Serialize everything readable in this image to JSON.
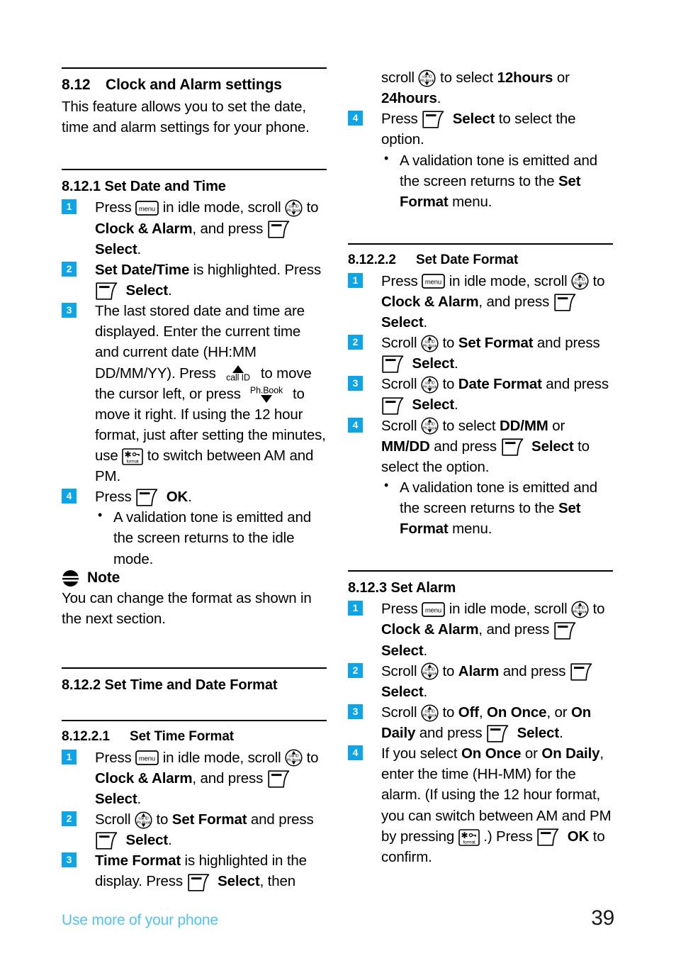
{
  "document": {
    "page_number": "39",
    "footer_label": "Use more of your phone",
    "accent_color": "#0CA6E8",
    "footer_color": "#4FC3F7"
  },
  "icons": {
    "menu": "menu-key-icon",
    "menu_label": "menu",
    "scroll": "scroll-navigation-icon",
    "scroll_top_label": "call ID",
    "scroll_bottom_label": "Ph.Book",
    "softkey": "soft-key-icon",
    "format": "format-star-key-icon",
    "format_label": "format",
    "callid_up": "call-id-up-arrow-icon",
    "callid_label": "call ID",
    "phbook_down": "phone-book-down-arrow-icon",
    "phbook_label": "Ph.Book",
    "note": "note-icon"
  },
  "left_column": {
    "section_812": {
      "number": "8.12",
      "title": "Clock and Alarm settings",
      "intro": "This feature allows you to set the date, time and alarm settings for your phone."
    },
    "section_8121": {
      "heading": "8.12.1 Set Date and Time",
      "steps": [
        {
          "num": "1",
          "parts": [
            {
              "t": "text",
              "v": "Press "
            },
            {
              "t": "icon",
              "v": "menu"
            },
            {
              "t": "text",
              "v": " in idle mode, scroll "
            },
            {
              "t": "icon",
              "v": "scroll"
            },
            {
              "t": "text",
              "v": " to "
            },
            {
              "t": "bold",
              "v": "Clock & Alarm"
            },
            {
              "t": "text",
              "v": ", and press "
            },
            {
              "t": "icon",
              "v": "softkey"
            },
            {
              "t": "bold",
              "v": "Select"
            },
            {
              "t": "text",
              "v": "."
            }
          ]
        },
        {
          "num": "2",
          "parts": [
            {
              "t": "bold",
              "v": "Set Date/Time"
            },
            {
              "t": "text",
              "v": " is highlighted. Press "
            },
            {
              "t": "icon",
              "v": "softkey"
            },
            {
              "t": "bold",
              "v": "Select"
            },
            {
              "t": "text",
              "v": "."
            }
          ]
        },
        {
          "num": "3",
          "parts": [
            {
              "t": "text",
              "v": "The last stored date and time are displayed. Enter the current time and current date (HH:MM DD/MM/YY). Press "
            },
            {
              "t": "icon",
              "v": "callid_up"
            },
            {
              "t": "text",
              "v": " to move the cursor left, or press "
            },
            {
              "t": "icon",
              "v": "phbook_down"
            },
            {
              "t": "text",
              "v": " to move it right. If using the 12 hour format, just after setting the minutes, use "
            },
            {
              "t": "icon",
              "v": "format"
            },
            {
              "t": "text",
              "v": " to switch between AM and PM."
            }
          ]
        },
        {
          "num": "4",
          "parts": [
            {
              "t": "text",
              "v": "Press "
            },
            {
              "t": "icon",
              "v": "softkey"
            },
            {
              "t": "bold",
              "v": "OK"
            },
            {
              "t": "text",
              "v": "."
            }
          ],
          "bullets": [
            [
              {
                "t": "text",
                "v": "A validation tone is emitted and the screen returns to the idle mode."
              }
            ]
          ]
        }
      ]
    },
    "note": {
      "title": "Note",
      "body": "You can change the format as shown in the next section."
    },
    "section_8122": {
      "heading": "8.12.2 Set Time and Date Format"
    },
    "section_81221": {
      "number": "8.12.2.1",
      "title": "Set Time Format",
      "steps": [
        {
          "num": "1",
          "parts": [
            {
              "t": "text",
              "v": "Press "
            },
            {
              "t": "icon",
              "v": "menu"
            },
            {
              "t": "text",
              "v": " in idle mode, scroll "
            },
            {
              "t": "icon",
              "v": "scroll"
            },
            {
              "t": "text",
              "v": " to "
            },
            {
              "t": "bold",
              "v": "Clock & Alarm"
            },
            {
              "t": "text",
              "v": ", and press "
            },
            {
              "t": "icon",
              "v": "softkey"
            },
            {
              "t": "bold",
              "v": "Select"
            },
            {
              "t": "text",
              "v": "."
            }
          ]
        },
        {
          "num": "2",
          "parts": [
            {
              "t": "text",
              "v": "Scroll "
            },
            {
              "t": "icon",
              "v": "scroll"
            },
            {
              "t": "text",
              "v": " to "
            },
            {
              "t": "bold",
              "v": "Set Format"
            },
            {
              "t": "text",
              "v": " and press "
            },
            {
              "t": "icon",
              "v": "softkey"
            },
            {
              "t": "bold",
              "v": "Select"
            },
            {
              "t": "text",
              "v": "."
            }
          ]
        },
        {
          "num": "3",
          "parts": [
            {
              "t": "bold",
              "v": "Time Format"
            },
            {
              "t": "text",
              "v": " is highlighted in the display. Press "
            },
            {
              "t": "icon",
              "v": "softkey"
            },
            {
              "t": "bold",
              "v": "Select"
            },
            {
              "t": "text",
              "v": ", then"
            }
          ]
        }
      ]
    }
  },
  "right_column": {
    "continuation": {
      "steps": [
        {
          "num": "",
          "parts": [
            {
              "t": "text",
              "v": "scroll "
            },
            {
              "t": "icon",
              "v": "scroll"
            },
            {
              "t": "text",
              "v": " to select "
            },
            {
              "t": "bold",
              "v": "12hours"
            },
            {
              "t": "text",
              "v": " or "
            },
            {
              "t": "bold",
              "v": "24hours"
            },
            {
              "t": "text",
              "v": "."
            }
          ]
        },
        {
          "num": "4",
          "parts": [
            {
              "t": "text",
              "v": "Press "
            },
            {
              "t": "icon",
              "v": "softkey"
            },
            {
              "t": "bold",
              "v": "Select"
            },
            {
              "t": "text",
              "v": " to select the option."
            }
          ],
          "bullets": [
            [
              {
                "t": "text",
                "v": "A validation tone is emitted and the screen returns to the "
              },
              {
                "t": "bold",
                "v": "Set Format"
              },
              {
                "t": "text",
                "v": " menu."
              }
            ]
          ]
        }
      ]
    },
    "section_81222": {
      "number": "8.12.2.2",
      "title": "Set Date Format",
      "steps": [
        {
          "num": "1",
          "parts": [
            {
              "t": "text",
              "v": "Press "
            },
            {
              "t": "icon",
              "v": "menu"
            },
            {
              "t": "text",
              "v": " in idle mode, scroll "
            },
            {
              "t": "icon",
              "v": "scroll"
            },
            {
              "t": "text",
              "v": " to "
            },
            {
              "t": "bold",
              "v": "Clock & Alarm"
            },
            {
              "t": "text",
              "v": ", and press "
            },
            {
              "t": "icon",
              "v": "softkey"
            },
            {
              "t": "bold",
              "v": "Select"
            },
            {
              "t": "text",
              "v": "."
            }
          ]
        },
        {
          "num": "2",
          "parts": [
            {
              "t": "text",
              "v": "Scroll "
            },
            {
              "t": "icon",
              "v": "scroll"
            },
            {
              "t": "text",
              "v": " to "
            },
            {
              "t": "bold",
              "v": "Set Format"
            },
            {
              "t": "text",
              "v": " and press "
            },
            {
              "t": "icon",
              "v": "softkey"
            },
            {
              "t": "bold",
              "v": "Select"
            },
            {
              "t": "text",
              "v": "."
            }
          ]
        },
        {
          "num": "3",
          "parts": [
            {
              "t": "text",
              "v": "Scroll "
            },
            {
              "t": "icon",
              "v": "scroll"
            },
            {
              "t": "text",
              "v": " to "
            },
            {
              "t": "bold",
              "v": "Date Format"
            },
            {
              "t": "text",
              "v": " and press "
            },
            {
              "t": "icon",
              "v": "softkey"
            },
            {
              "t": "bold",
              "v": "Select"
            },
            {
              "t": "text",
              "v": "."
            }
          ]
        },
        {
          "num": "4",
          "parts": [
            {
              "t": "text",
              "v": "Scroll "
            },
            {
              "t": "icon",
              "v": "scroll"
            },
            {
              "t": "text",
              "v": " to select "
            },
            {
              "t": "bold",
              "v": "DD/MM"
            },
            {
              "t": "text",
              "v": " or "
            },
            {
              "t": "bold",
              "v": "MM/DD"
            },
            {
              "t": "text",
              "v": " and press "
            },
            {
              "t": "icon",
              "v": "softkey"
            },
            {
              "t": "bold",
              "v": "Select"
            },
            {
              "t": "text",
              "v": " to select the option."
            }
          ],
          "bullets": [
            [
              {
                "t": "text",
                "v": "A validation tone is emitted and the screen returns to the "
              },
              {
                "t": "bold",
                "v": "Set Format"
              },
              {
                "t": "text",
                "v": " menu."
              }
            ]
          ]
        }
      ]
    },
    "section_8123": {
      "heading": "8.12.3 Set Alarm",
      "steps": [
        {
          "num": "1",
          "parts": [
            {
              "t": "text",
              "v": "Press "
            },
            {
              "t": "icon",
              "v": "menu"
            },
            {
              "t": "text",
              "v": " in idle mode, scroll "
            },
            {
              "t": "icon",
              "v": "scroll"
            },
            {
              "t": "text",
              "v": " to "
            },
            {
              "t": "bold",
              "v": "Clock & Alarm"
            },
            {
              "t": "text",
              "v": ", and press "
            },
            {
              "t": "icon",
              "v": "softkey"
            },
            {
              "t": "bold",
              "v": "Select"
            },
            {
              "t": "text",
              "v": "."
            }
          ]
        },
        {
          "num": "2",
          "parts": [
            {
              "t": "text",
              "v": "Scroll "
            },
            {
              "t": "icon",
              "v": "scroll"
            },
            {
              "t": "text",
              "v": " to "
            },
            {
              "t": "bold",
              "v": "Alarm"
            },
            {
              "t": "text",
              "v": " and press "
            },
            {
              "t": "icon",
              "v": "softkey"
            },
            {
              "t": "bold",
              "v": "Select"
            },
            {
              "t": "text",
              "v": "."
            }
          ]
        },
        {
          "num": "3",
          "parts": [
            {
              "t": "text",
              "v": "Scroll "
            },
            {
              "t": "icon",
              "v": "scroll"
            },
            {
              "t": "text",
              "v": " to "
            },
            {
              "t": "bold",
              "v": "Off"
            },
            {
              "t": "text",
              "v": ", "
            },
            {
              "t": "bold",
              "v": "On Once"
            },
            {
              "t": "text",
              "v": ", or "
            },
            {
              "t": "bold",
              "v": "On Daily"
            },
            {
              "t": "text",
              "v": " and press "
            },
            {
              "t": "icon",
              "v": "softkey"
            },
            {
              "t": "bold",
              "v": "Select"
            },
            {
              "t": "text",
              "v": "."
            }
          ]
        },
        {
          "num": "4",
          "parts": [
            {
              "t": "text",
              "v": "If you select "
            },
            {
              "t": "bold",
              "v": "On Once"
            },
            {
              "t": "text",
              "v": " or "
            },
            {
              "t": "bold",
              "v": "On Daily"
            },
            {
              "t": "text",
              "v": ", enter the time (HH-MM) for the alarm. (If using the 12 hour format, you can switch between AM and PM by pressing "
            },
            {
              "t": "icon",
              "v": "format"
            },
            {
              "t": "text",
              "v": ".) Press "
            },
            {
              "t": "icon",
              "v": "softkey"
            },
            {
              "t": "bold",
              "v": "OK"
            },
            {
              "t": "text",
              "v": " to confirm."
            }
          ]
        }
      ]
    }
  }
}
